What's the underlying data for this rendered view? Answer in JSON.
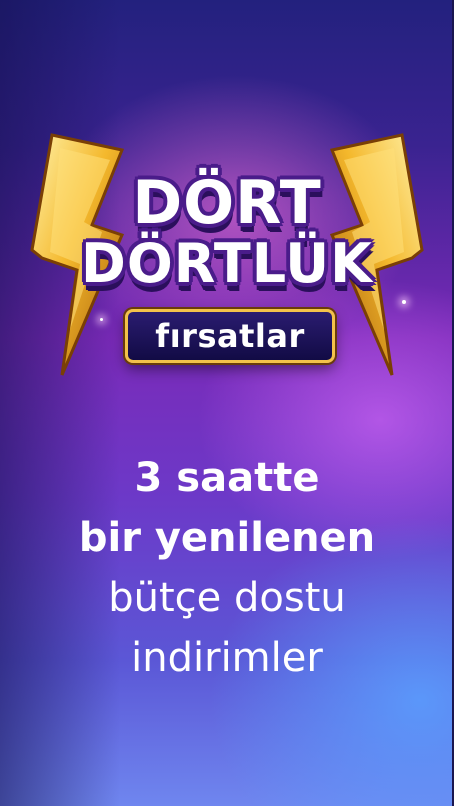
{
  "promo": {
    "title_line1": "DÖRT",
    "title_line2": "DÖRTLÜK",
    "tag": "fırsatlar"
  },
  "headline": {
    "line1": "3 saatte",
    "line2": "bir yenilenen",
    "line3": "bütçe dostu",
    "line4": "indirimler"
  },
  "colors": {
    "gold": "#f3c24a",
    "purple_outline": "#4a1c8a",
    "background_top": "#23217e",
    "background_bottom": "#6f86ef"
  },
  "icons": {
    "left_bolt": "lightning-bolt-icon",
    "right_bolt": "lightning-bolt-icon"
  }
}
